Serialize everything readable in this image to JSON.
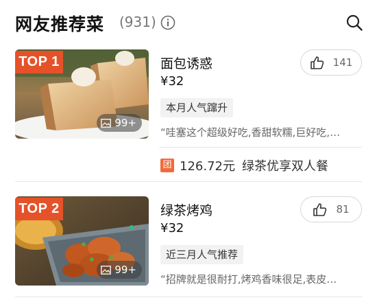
{
  "header": {
    "title": "网友推荐菜",
    "count": "(931)",
    "info_icon": "info-icon",
    "search_icon": "search-icon"
  },
  "dishes": [
    {
      "rank": "TOP 1",
      "name": "面包诱惑",
      "price": "¥32",
      "tag": "本月人气蹿升",
      "quote": "“哇塞这个超级好吃,香甜软糯,巨好吃,…",
      "likes": "141",
      "photo_count": "99+",
      "photo": "toast-dessert-photo"
    },
    {
      "rank": "TOP 2",
      "name": "绿茶烤鸡",
      "price": "¥32",
      "tag": "近三月人气推荐",
      "quote": "“招牌就是很耐打,烤鸡香味很足,表皮…",
      "likes": "81",
      "photo_count": "99+",
      "photo": "roast-chicken-photo"
    }
  ],
  "deal": {
    "icon_label": "团",
    "price": "126.72元",
    "title": "绿茶优享双人餐"
  },
  "colors": {
    "badge": "#e55229",
    "deal_icon": "#f26a3a"
  }
}
